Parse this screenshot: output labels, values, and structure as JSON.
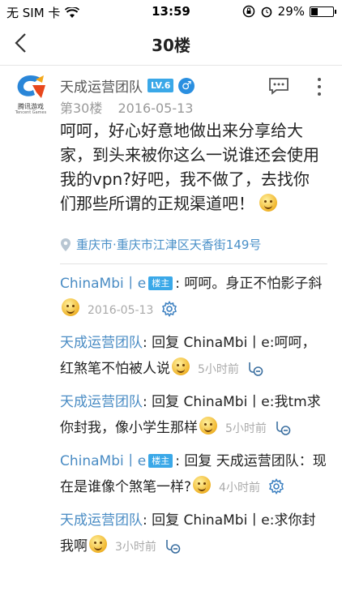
{
  "status_bar": {
    "carrier": "无 SIM 卡",
    "time": "13:59",
    "battery": "29%",
    "battery_level": 0.29
  },
  "nav": {
    "title": "30楼"
  },
  "post": {
    "author": "天成运营团队",
    "level": "LV.6",
    "floor": "第30楼",
    "date": "2016-05-13",
    "avatar_caption": "腾讯游戏",
    "avatar_caption_en": "Tencent Games",
    "content": "呵呵，好心好意地做出来分享给大家，到头来被你这么一说谁还会使用我的vpn?好吧，我不做了，去找你们那些所谓的正规渠道吧！",
    "location": "重庆市·重庆市江津区天香街149号"
  },
  "replies": [
    {
      "user": "ChinaMbi丨e",
      "host_badge": "楼主",
      "prefix": "",
      "target": "",
      "text": "呵呵。身正不怕影子斜",
      "time": "2016-05-13",
      "icon": "gear-icon"
    },
    {
      "user": "天成运营团队",
      "host_badge": "",
      "prefix": "回复 ",
      "target": "ChinaMbi丨e",
      "text": ":呵呵，红煞笔不怕被人说",
      "time": "5小时前",
      "icon": "reply-icon"
    },
    {
      "user": "天成运营团队",
      "host_badge": "",
      "prefix": "回复 ",
      "target": "ChinaMbi丨e",
      "text": ":我tm求你封我，像小学生那样",
      "time": "5小时前",
      "icon": "reply-icon"
    },
    {
      "user": "ChinaMbi丨e",
      "host_badge": "楼主",
      "prefix": "回复 ",
      "target": "天成运营团队",
      "text": "：现在是谁像个煞笔一样?",
      "time": "4小时前",
      "icon": "gear-icon"
    },
    {
      "user": "天成运营团队",
      "host_badge": "",
      "prefix": "回复 ",
      "target": "ChinaMbi丨e",
      "text": ":求你封我啊",
      "time": "3小时前",
      "icon": "reply-icon"
    }
  ]
}
